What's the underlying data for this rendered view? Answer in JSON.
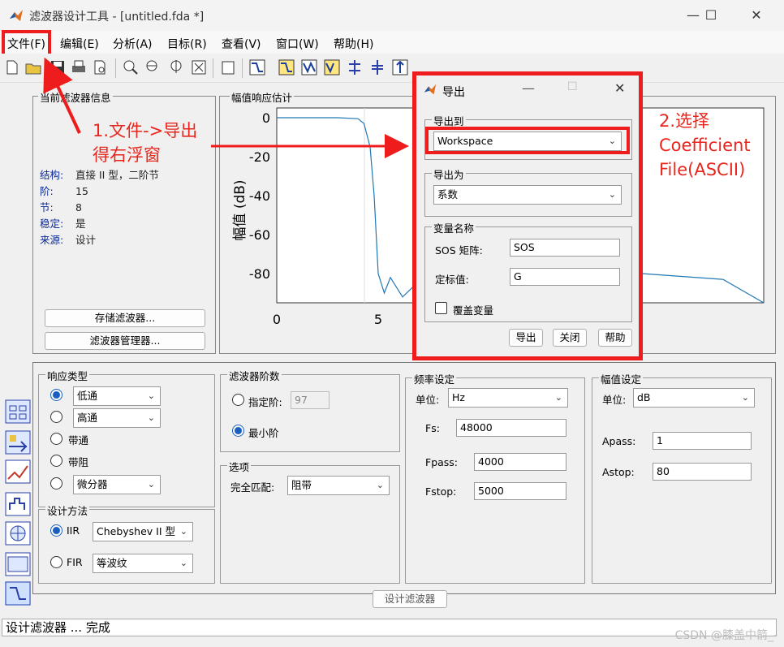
{
  "window": {
    "title": "滤波器设计工具 -  [untitled.fda *]",
    "minimize_glyph": "—",
    "maximize_glyph": "☐",
    "close_glyph": "✕"
  },
  "menu": [
    "文件(F)",
    "编辑(E)",
    "分析(A)",
    "目标(R)",
    "查看(V)",
    "窗口(W)",
    "帮助(H)"
  ],
  "current_filter_info": {
    "title": "当前滤波器信息",
    "rows": [
      {
        "key": "结构:",
        "value": "直接 II 型，二阶节"
      },
      {
        "key": "阶:",
        "value": "15"
      },
      {
        "key": "节:",
        "value": "8"
      },
      {
        "key": "稳定:",
        "value": "是"
      },
      {
        "key": "来源:",
        "value": "设计"
      }
    ],
    "store_button": "存储滤波器...",
    "manager_button": "滤波器管理器..."
  },
  "plot": {
    "title": "幅值响应估计",
    "ylabel": "幅值 (dB)",
    "yticks": [
      "0",
      "-20",
      "-40",
      "-60",
      "-80"
    ],
    "xticks": [
      "0",
      "5"
    ]
  },
  "chart_data": {
    "type": "line",
    "title": "幅值响应估计",
    "xlabel": "",
    "ylabel": "幅值 (dB)",
    "xlim": [
      0,
      24
    ],
    "ylim": [
      -95,
      5
    ],
    "series": [
      {
        "x": [
          0,
          3,
          4,
          4.3,
          4.6,
          4.8,
          5.0,
          5.3,
          5.6,
          6.2,
          7,
          8,
          10,
          14,
          18,
          22,
          24
        ],
        "y": [
          0,
          0,
          -0.5,
          -3,
          -15,
          -40,
          -80,
          -90,
          -82,
          -92,
          -84,
          -95,
          -85,
          -82,
          -80,
          -83,
          -95
        ]
      }
    ]
  },
  "export_dialog": {
    "title": "导出",
    "export_to_label": "导出到",
    "export_to_value": "Workspace",
    "export_as_label": "导出为",
    "export_as_value": "系数",
    "var_names_label": "变量名称",
    "sos_label": "SOS 矩阵:",
    "sos_value": "SOS",
    "gain_label": "定标值:",
    "gain_value": "G",
    "overwrite_label": "覆盖变量",
    "export_button": "导出",
    "close_button": "关闭",
    "help_button": "帮助"
  },
  "response_type": {
    "title": "响应类型",
    "lowpass": "低通",
    "highpass": "高通",
    "bandpass": "带通",
    "bandstop": "带阻",
    "differentiator": "微分器"
  },
  "design_method": {
    "title": "设计方法",
    "iir_label": "IIR",
    "iir_value": "Chebyshev II 型",
    "fir_label": "FIR",
    "fir_value": "等波纹"
  },
  "filter_order": {
    "title": "滤波器阶数",
    "specify_label": "指定阶:",
    "specify_value": "97",
    "minimum_label": "最小阶"
  },
  "options": {
    "title": "选项",
    "match_label": "完全匹配:",
    "match_value": "阻带"
  },
  "freq_spec": {
    "title": "频率设定",
    "unit_label": "单位:",
    "unit_value": "Hz",
    "fs_label": "Fs:",
    "fs_value": "48000",
    "fpass_label": "Fpass:",
    "fpass_value": "4000",
    "fstop_label": "Fstop:",
    "fstop_value": "5000"
  },
  "mag_spec": {
    "title": "幅值设定",
    "unit_label": "单位:",
    "unit_value": "dB",
    "apass_label": "Apass:",
    "apass_value": "1",
    "astop_label": "Astop:",
    "astop_value": "80"
  },
  "design_button": "设计滤波器",
  "status": "设计滤波器 ... 完成",
  "annotations": {
    "step1_line1": "1.文件->导出",
    "step1_line2": "得右浮窗",
    "step2_line1": "2.选择",
    "step2_line2": "Coefficient",
    "step2_line3": "File(ASCII)"
  },
  "watermark": "CSDN @膝盖中箭_-",
  "colors": {
    "annotation_red": "#ee1c1c",
    "plot_line": "#1f77b4",
    "info_key": "#0a2a9a"
  }
}
